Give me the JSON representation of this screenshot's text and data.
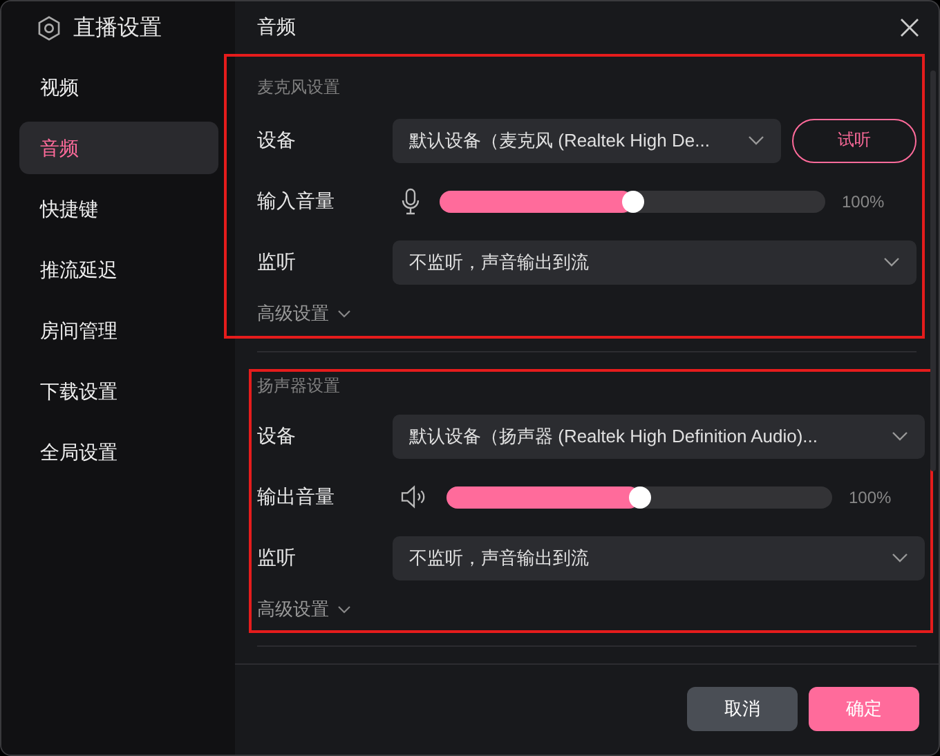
{
  "sidebar": {
    "title": "直播设置",
    "items": [
      {
        "label": "视频",
        "selected": false
      },
      {
        "label": "音频",
        "selected": true
      },
      {
        "label": "快捷键",
        "selected": false
      },
      {
        "label": "推流延迟",
        "selected": false
      },
      {
        "label": "房间管理",
        "selected": false
      },
      {
        "label": "下载设置",
        "selected": false
      },
      {
        "label": "全局设置",
        "selected": false
      }
    ]
  },
  "header": {
    "title": "音频"
  },
  "sections": [
    {
      "kind": "microphone",
      "title": "麦克风设置",
      "highlighted": true,
      "rows": [
        {
          "kind": "select",
          "label": "设备",
          "value": "默认设备（麦克风 (Realtek High De...",
          "button": "试听"
        },
        {
          "kind": "slider",
          "label": "输入音量",
          "level": 0.5,
          "reading": "100%"
        },
        {
          "kind": "select",
          "label": "监听",
          "value": "不监听，声音输出到流"
        }
      ],
      "advanced": "高级设置"
    },
    {
      "kind": "speaker",
      "title": "扬声器设置",
      "highlighted": true,
      "rows": [
        {
          "kind": "select",
          "label": "设备",
          "value": "默认设备（扬声器 (Realtek High Definition Audio)..."
        },
        {
          "kind": "slider",
          "label": "输出音量",
          "level": 0.5,
          "reading": "100%"
        },
        {
          "kind": "select",
          "label": "监听",
          "value": "不监听，声音输出到流"
        }
      ],
      "advanced": "高级设置"
    }
  ],
  "footer": {
    "buttons": [
      {
        "label": "取消",
        "kind": "secondary"
      },
      {
        "label": "确定",
        "kind": "primary"
      }
    ]
  }
}
